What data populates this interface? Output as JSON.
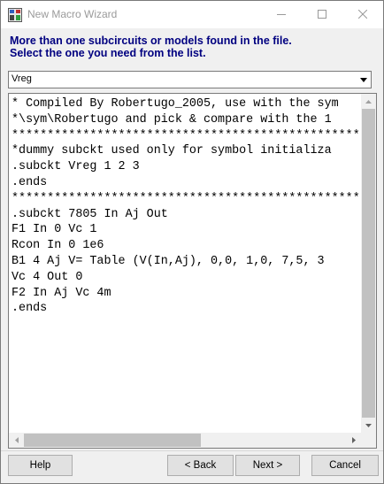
{
  "window": {
    "title": "New Macro Wizard",
    "app_icon": "macro-wizard-icon",
    "controls": [
      "minimize-icon",
      "maximize-icon",
      "close-icon"
    ]
  },
  "instructions": {
    "line1": "More than one subcircuits or models found in the file.",
    "line2": "Select the one you need from the list."
  },
  "combo": {
    "selected": "Vreg",
    "icon": "chevron-down-icon"
  },
  "content": {
    "lines": [
      "* Compiled By Robertugo_2005, use with the sym",
      "*\\sym\\Robertugo and pick & compare with the 1",
      "****************************************************",
      "*dummy subckt used only for symbol initializa",
      ".subckt Vreg 1 2 3",
      ".ends",
      "****************************************************",
      ".subckt 7805 In Aj Out",
      "F1 In 0 Vc 1",
      "Rcon In 0 1e6",
      "B1 4 Aj V= Table (V(In,Aj), 0,0, 1,0, 7,5, 3",
      "Vc 4 Out 0",
      "F2 In Aj Vc 4m",
      ".ends"
    ]
  },
  "buttons": {
    "help": "Help",
    "back": "< Back",
    "next": "Next >",
    "cancel": "Cancel"
  },
  "colors": {
    "instruction_text": "#000080",
    "window_bg": "#f0f0f0"
  }
}
